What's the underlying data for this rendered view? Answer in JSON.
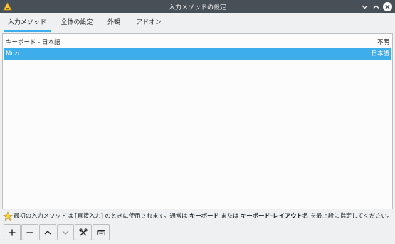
{
  "window": {
    "title": "入力メソッドの設定",
    "app_icon": "keyboard-config-icon",
    "controls": [
      "minimize-icon",
      "maximize-icon",
      "close-icon"
    ]
  },
  "tabs": [
    {
      "label": "入力メソッド",
      "active": true
    },
    {
      "label": "全体の設定",
      "active": false
    },
    {
      "label": "外観",
      "active": false
    },
    {
      "label": "アドオン",
      "active": false
    }
  ],
  "list": {
    "rows": [
      {
        "name": "キーボード - 日本語",
        "language": "不明",
        "selected": false
      },
      {
        "name": "Mozc",
        "language": "日本語",
        "selected": true
      }
    ]
  },
  "hint": {
    "icon": "star-icon",
    "part1": "最初の入力メソッドは [直接入力] のときに使用されます。通常は",
    "bold1": "キーボード",
    "part2": "または",
    "bold2": "キーボード-レイアウト名",
    "part3": "を最上段に指定してください。"
  },
  "toolbar": {
    "buttons": [
      "add-icon",
      "remove-icon",
      "move-up-icon",
      "move-down-icon",
      "configure-icon",
      "keyboard-layout-icon"
    ]
  },
  "colors": {
    "titlebar": "#475057",
    "accent": "#3daee9",
    "background": "#eff0f1",
    "panel": "#fcfcfc"
  }
}
